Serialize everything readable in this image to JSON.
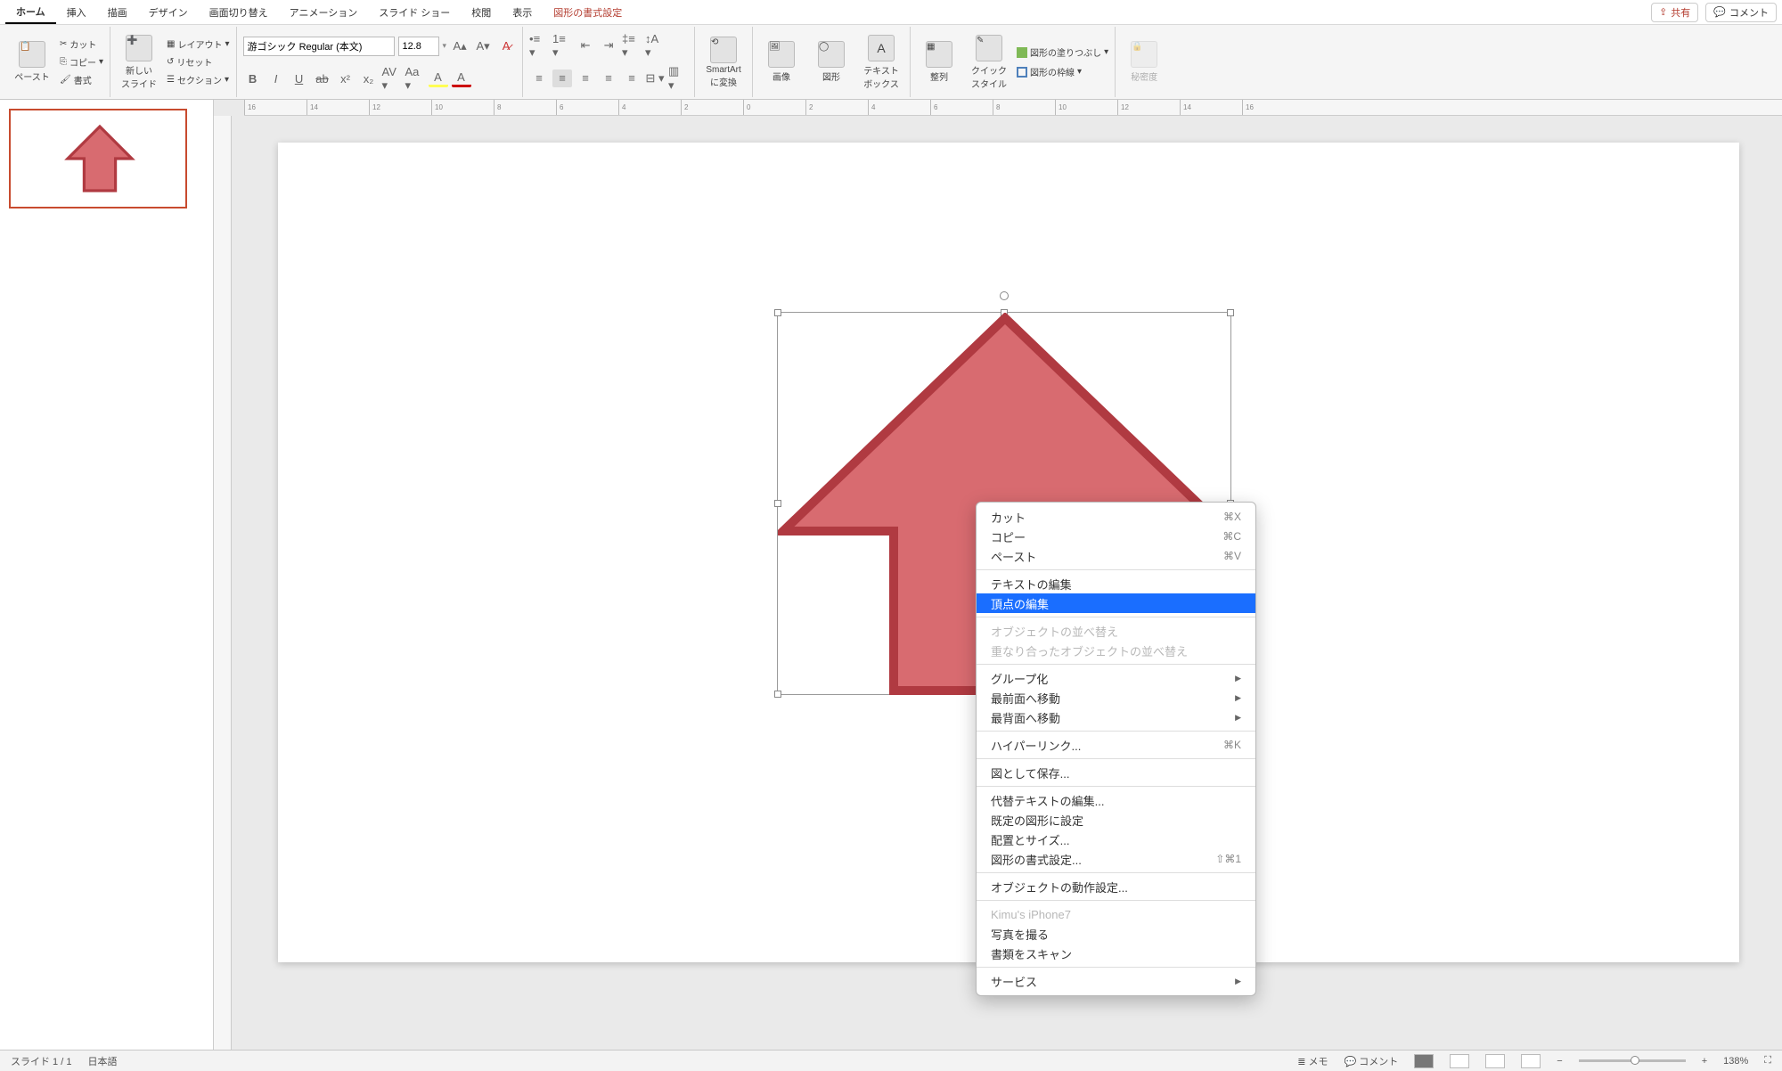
{
  "menu": {
    "tabs": [
      "ホーム",
      "挿入",
      "描画",
      "デザイン",
      "画面切り替え",
      "アニメーション",
      "スライド ショー",
      "校閲",
      "表示",
      "図形の書式設定"
    ],
    "active_index": 0,
    "context_index": 9,
    "share": "共有",
    "comment": "コメント"
  },
  "ribbon": {
    "paste": "ペースト",
    "cut": "カット",
    "copy": "コピー",
    "format_painter": "書式",
    "new_slide": "新しい\nスライド",
    "layout": "レイアウト",
    "reset": "リセット",
    "section": "セクション",
    "font_name": "游ゴシック Regular (本文)",
    "font_size": "12.8",
    "smartart": "SmartArt\nに変換",
    "picture": "画像",
    "shapes_btn": "図形",
    "textbox": "テキスト\nボックス",
    "arrange": "整列",
    "quick_styles": "クイック\nスタイル",
    "shape_fill": "図形の塗りつぶし",
    "shape_outline": "図形の枠線",
    "sensitivity": "秘密度"
  },
  "shape": {
    "fill": "#d86b70",
    "stroke": "#b03a41"
  },
  "context_menu": {
    "items": [
      {
        "label": "カット",
        "shortcut": "⌘X",
        "type": "plain"
      },
      {
        "label": "コピー",
        "shortcut": "⌘C",
        "type": "plain"
      },
      {
        "label": "ペースト",
        "shortcut": "⌘V",
        "type": "plain"
      },
      {
        "type": "sep"
      },
      {
        "label": "テキストの編集",
        "type": "plain"
      },
      {
        "label": "頂点の編集",
        "type": "selected"
      },
      {
        "type": "sep"
      },
      {
        "label": "オブジェクトの並べ替え",
        "type": "disabled"
      },
      {
        "label": "重なり合ったオブジェクトの並べ替え",
        "type": "disabled"
      },
      {
        "type": "sep"
      },
      {
        "label": "グループ化",
        "type": "submenu"
      },
      {
        "label": "最前面へ移動",
        "type": "submenu"
      },
      {
        "label": "最背面へ移動",
        "type": "submenu"
      },
      {
        "type": "sep"
      },
      {
        "label": "ハイパーリンク...",
        "shortcut": "⌘K",
        "type": "plain"
      },
      {
        "type": "sep"
      },
      {
        "label": "図として保存...",
        "type": "plain"
      },
      {
        "type": "sep"
      },
      {
        "label": "代替テキストの編集...",
        "type": "plain"
      },
      {
        "label": "既定の図形に設定",
        "type": "plain"
      },
      {
        "label": "配置とサイズ...",
        "type": "plain"
      },
      {
        "label": "図形の書式設定...",
        "shortcut": "⇧⌘1",
        "type": "plain"
      },
      {
        "type": "sep"
      },
      {
        "label": "オブジェクトの動作設定...",
        "type": "plain"
      },
      {
        "type": "sep"
      },
      {
        "label": "Kimu's iPhone7",
        "type": "disabled"
      },
      {
        "label": "写真を撮る",
        "type": "plain"
      },
      {
        "label": "書類をスキャン",
        "type": "plain"
      },
      {
        "type": "sep"
      },
      {
        "label": "サービス",
        "type": "submenu"
      }
    ]
  },
  "status": {
    "slide_counter": "スライド 1 / 1",
    "language": "日本語",
    "notes": "メモ",
    "comments": "コメント",
    "zoom": "138%"
  },
  "ruler_ticks": [
    "16",
    "14",
    "12",
    "10",
    "8",
    "6",
    "4",
    "2",
    "0",
    "2",
    "4",
    "6",
    "8",
    "10",
    "12",
    "14",
    "16"
  ]
}
